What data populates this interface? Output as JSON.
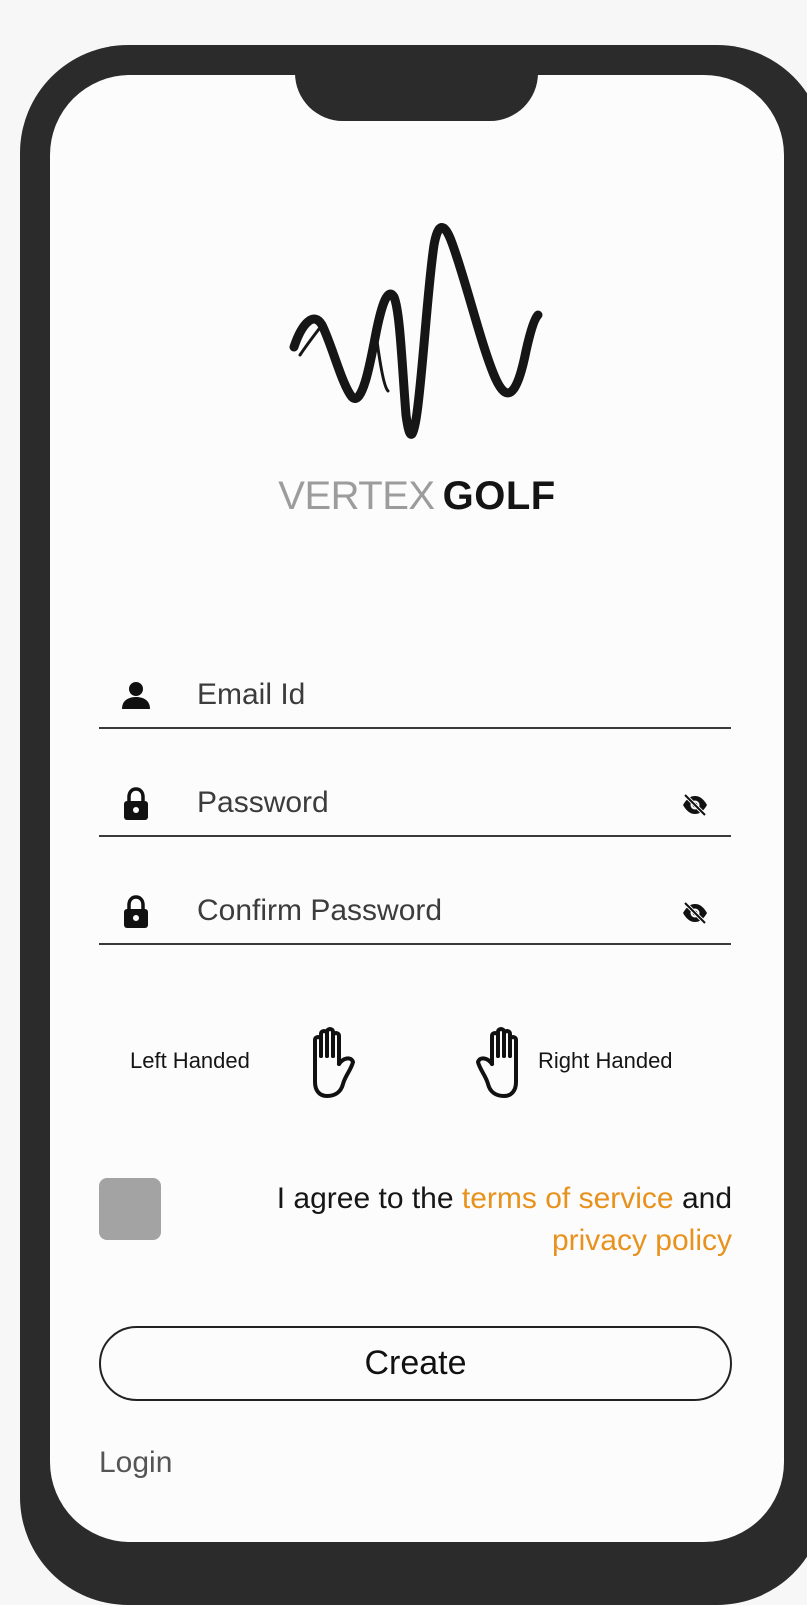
{
  "brand": {
    "light": "VERTEX",
    "bold": "GOLF"
  },
  "form": {
    "email_placeholder": "Email Id",
    "password_placeholder": "Password",
    "confirm_placeholder": "Confirm Password"
  },
  "handedness": {
    "left_label": "Left Handed",
    "right_label": "Right Handed"
  },
  "terms": {
    "prefix": "I agree to the ",
    "terms_link": "terms of service",
    "middle": " and",
    "privacy_link": "privacy policy",
    "checked": false
  },
  "actions": {
    "create_label": "Create",
    "login_label": "Login"
  },
  "icons": {
    "email": "person-icon",
    "password": "lock-icon",
    "confirm": "lock-icon",
    "visibility": "eye-off-icon",
    "left_hand": "hand-icon",
    "right_hand": "hand-icon"
  },
  "colors": {
    "link": "#e8921e",
    "frame": "#2b2b2b",
    "checkbox": "#a3a3a3",
    "brand_light": "#9c9c9c",
    "brand_bold": "#141414"
  }
}
